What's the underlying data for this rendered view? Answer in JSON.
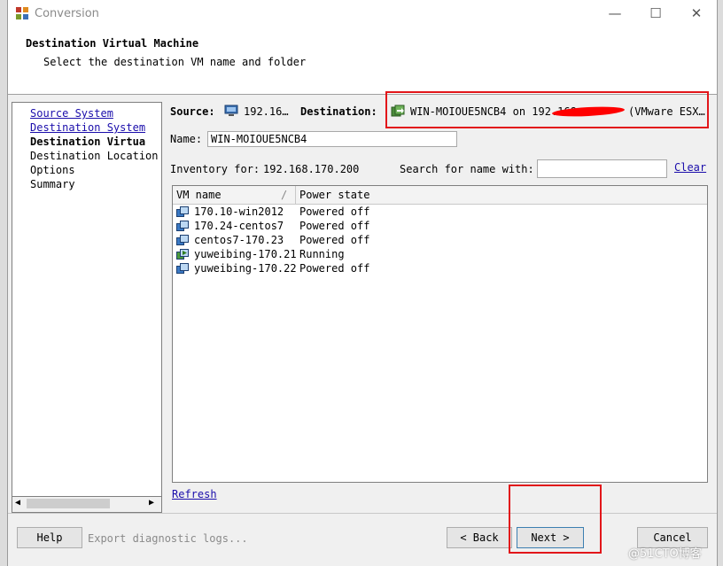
{
  "window": {
    "title": "Conversion",
    "minimize": "—",
    "maximize": "☐",
    "close": "✕"
  },
  "header": {
    "title": "Destination Virtual Machine",
    "subtitle": "Select the destination VM name and folder"
  },
  "nav": {
    "items": [
      {
        "label": "Source System",
        "state": "link"
      },
      {
        "label": "Destination System",
        "state": "link"
      },
      {
        "label": "Destination Virtua",
        "state": "current"
      },
      {
        "label": "Destination Location",
        "state": "normal"
      },
      {
        "label": "Options",
        "state": "normal"
      },
      {
        "label": "Summary",
        "state": "normal"
      }
    ]
  },
  "summary": {
    "source_label": "Source:",
    "source_value": "192.16…",
    "destination_label": "Destination:",
    "destination_value": "WIN-MOIOUE5NCB4 on 192.168.",
    "destination_suffix": "(VMware ESX…"
  },
  "name_field": {
    "label": "Name:",
    "value": "WIN-MOIOUE5NCB4"
  },
  "inventory": {
    "label": "Inventory for:",
    "host": "192.168.170.200"
  },
  "search": {
    "label": "Search for name with:",
    "value": "",
    "clear": "Clear"
  },
  "table": {
    "columns": [
      "VM name",
      "Power state"
    ],
    "rows": [
      {
        "name": "170.10-win2012",
        "state": "Powered off",
        "running": false
      },
      {
        "name": "170.24-centos7",
        "state": "Powered off",
        "running": false
      },
      {
        "name": "centos7-170.23",
        "state": "Powered off",
        "running": false
      },
      {
        "name": "yuweibing-170.21",
        "state": "Running",
        "running": true
      },
      {
        "name": "yuweibing-170.22",
        "state": "Powered off",
        "running": false
      }
    ]
  },
  "refresh": "Refresh",
  "footer": {
    "help": "Help",
    "export_logs": "Export diagnostic logs...",
    "back": "< Back",
    "next": "Next >",
    "cancel": "Cancel"
  },
  "watermark": "@51CTO博客",
  "colors": {
    "link": "#1a0dab",
    "annotation": "#e2161a"
  }
}
